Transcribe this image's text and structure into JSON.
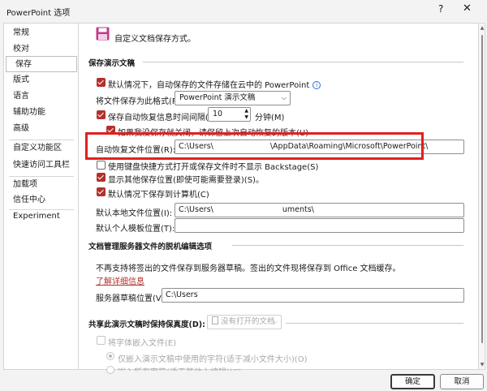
{
  "window": {
    "title": "PowerPoint 选项",
    "help": "?",
    "close": "✕"
  },
  "sidebar": {
    "items": [
      "常规",
      "校对",
      "保存",
      "版式",
      "语言",
      "辅助功能",
      "高级",
      "自定义功能区",
      "快速访问工具栏",
      "加载项",
      "信任中心",
      "Experiment"
    ]
  },
  "header": {
    "text": "自定义文档保存方式。"
  },
  "save_section": {
    "title": "保存演示文稿",
    "cloud_default_label": "默认情况下，自动保存的文件存储在云中的 PowerPoint",
    "format_label": "将文件保存为此格式(F):",
    "format_value": "PowerPoint 演示文稿",
    "autorecover_label": "保存自动恢复信息时间间隔(A)",
    "autorecover_minutes": "10",
    "minutes_label": "分钟(M)",
    "keep_last_label": "如果我没保存就关闭，请保留上次自动恢复的版本(U)",
    "autorecover_location_label": "自动恢复文件位置(R):",
    "autorecover_location_prefix": "C:\\Users\\",
    "autorecover_location_suffix": "\\AppData\\Roaming\\Microsoft\\PowerPoint\\",
    "backstage_label": "使用键盘快捷方式打开或保存文件时不显示 Backstage(S)",
    "show_more_locations_label": "显示其他保存位置(即使可能需要登录)(S)。",
    "save_to_computer_label": "默认情况下保存到计算机(C)",
    "local_location_label": "默认本地文件位置(I):",
    "local_location_prefix": "C:\\Users\\",
    "local_location_suffix": "uments\\",
    "template_location_label": "默认个人模板位置(T):",
    "template_location_value": ""
  },
  "offline_section": {
    "title": "文档管理服务器文件的脱机编辑选项",
    "description": "不再支持将签出的文件保存到服务器草稿。签出的文件现将保存到 Office 文档缓存。",
    "learn_more": "了解详细信息",
    "server_drafts_label": "服务器草稿位置(V):",
    "server_drafts_value": "C:\\Users"
  },
  "fidelity_section": {
    "title": "共享此演示文稿时保持保真度(D):",
    "doc_select": "没有打开的文档",
    "embed_fonts_label": "将字体嵌入文件(E)",
    "embed_used_label": "仅嵌入演示文稿中使用的字符(适于减小文件大小)(O)",
    "embed_all_label": "嵌入所有字符(适于其他人编辑)(C)"
  },
  "buttons": {
    "ok": "确定",
    "cancel": "取消"
  }
}
